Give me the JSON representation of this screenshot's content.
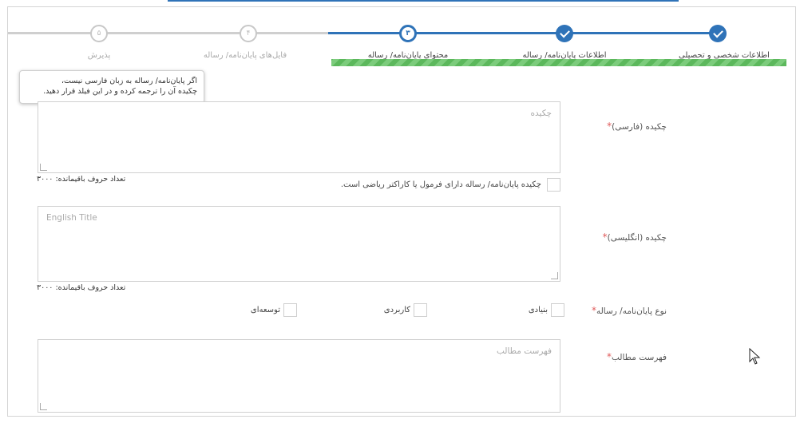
{
  "wizard": {
    "steps": [
      {
        "label": "اطلاعات شخصی و تحصیلی",
        "number": "",
        "state": "done"
      },
      {
        "label": "اطلاعات پایان‌نامه/ رساله",
        "number": "",
        "state": "done"
      },
      {
        "label": "محتوای پایان‌نامه/ رساله",
        "number": "۳",
        "state": "current"
      },
      {
        "label": "فایل‌های پایان‌نامه/ رساله",
        "number": "۴",
        "state": "todo"
      },
      {
        "label": "پذیرش",
        "number": "۵",
        "state": "todo"
      }
    ],
    "progress_percent": 60
  },
  "tooltip": {
    "line1": "اگر پایان‌نامه/ رساله به زبان فارسی نیست،",
    "line2": "چکیده آن را ترجمه کرده و در این فیلد قرار دهید."
  },
  "abstract_fa": {
    "label": "چکیده (فارسی)",
    "required_mark": "*",
    "placeholder": "چکیده",
    "remaining": "تعداد حروف باقیمانده: ۳۰۰۰",
    "formula_checkbox_label": "چکیده پایان‌نامه/ رساله دارای فرمول یا کاراکتر ریاضی است."
  },
  "abstract_en": {
    "label": "چکیده (انگلیسی)",
    "required_mark": "*",
    "placeholder": "English Title",
    "remaining": "تعداد حروف باقیمانده: ۳۰۰۰"
  },
  "thesis_type": {
    "label": "نوع پایان‌نامه/ رساله",
    "required_mark": "*",
    "options": [
      "بنیادی",
      "کاربردی",
      "توسعه‌ای"
    ]
  },
  "toc": {
    "label": "فهرست مطالب",
    "required_mark": "*",
    "placeholder": "فهرست مطالب"
  },
  "colors": {
    "accent": "#2f73b8",
    "progress": "#5cb85c",
    "required": "#e05b5b"
  }
}
